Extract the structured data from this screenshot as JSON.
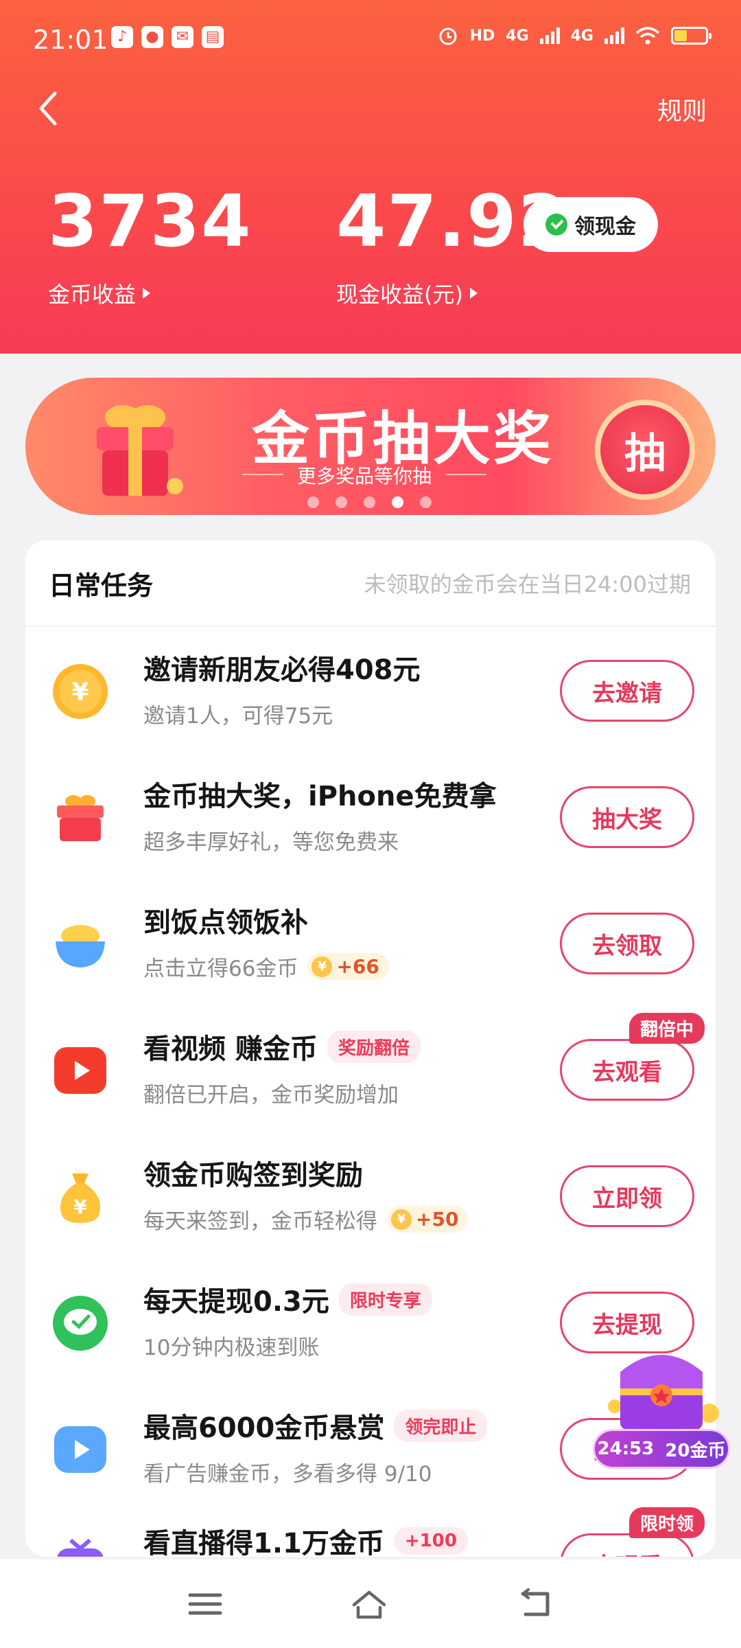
{
  "status_bar": {
    "time": "21:01",
    "left_icons": [
      "tiktok-icon",
      "message-icon",
      "mail-icon",
      "wallet-icon"
    ],
    "hd_label": "HD",
    "net1": "4G",
    "net2": "4G"
  },
  "header": {
    "rules": "规则",
    "coins_value": "3734",
    "coins_label": "金币收益",
    "cash_value": "47.92",
    "cash_label": "现金收益(元)",
    "cash_button": "领现金"
  },
  "banner": {
    "title": "金币抽大奖",
    "subtitle": "更多奖品等你抽",
    "action": "抽",
    "active_dot": 3,
    "dot_count": 5
  },
  "tasks_card": {
    "title": "日常任务",
    "note": "未领取的金币会在当日24:00过期",
    "tasks": [
      {
        "title": "邀请新朋友必得408元",
        "subtitle": "邀请1人，可得75元",
        "button": "去邀请",
        "icon": "yuan-coin-icon"
      },
      {
        "title": "金币抽大奖，iPhone免费拿",
        "subtitle": "超多丰厚好礼，等您免费来",
        "button": "抽大奖",
        "icon": "gift-box-icon"
      },
      {
        "title": "到饭点领饭补",
        "subtitle": "点击立得66金币",
        "reward": "+66",
        "button": "去领取",
        "icon": "rice-bowl-icon"
      },
      {
        "title": "看视频 赚金币",
        "tag": "奖励翻倍",
        "subtitle": "翻倍已开启，金币奖励增加",
        "button": "去观看",
        "badge": "翻倍中",
        "icon": "video-play-icon"
      },
      {
        "title": "领金币购签到奖励",
        "subtitle": "每天来签到，金币轻松得",
        "reward": "+50",
        "button": "立即领",
        "icon": "money-bag-icon"
      },
      {
        "title": "每天提现0.3元",
        "tag": "限时专享",
        "subtitle": "10分钟内极速到账",
        "button": "去提现",
        "icon": "wechat-pay-icon"
      },
      {
        "title": "最高6000金币悬赏",
        "tag": "领完即止",
        "subtitle": "看广告赚金币，多看多得 9/10",
        "button": "去观看",
        "icon": "ad-play-icon"
      },
      {
        "title": "看直播得1.1万金币",
        "tag": "+100",
        "subtitle": "",
        "button": "去观看",
        "badge": "限时领",
        "icon": "live-icon"
      }
    ]
  },
  "floating_chest": {
    "timer": "24:53",
    "reward": "20金币"
  },
  "colors": {
    "header_top": "#fb6240",
    "header_bottom": "#f73a57",
    "accent": "#e6385d"
  }
}
